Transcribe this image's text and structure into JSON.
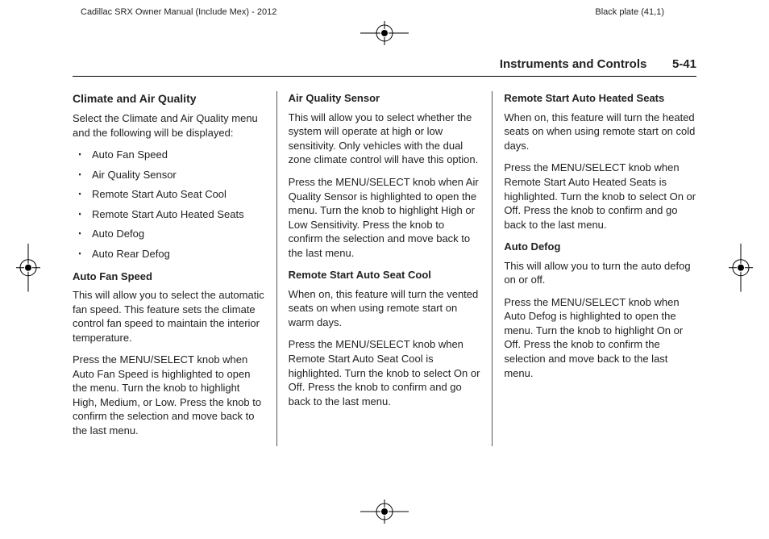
{
  "top": {
    "left": "Cadillac SRX Owner Manual (Include Mex) - 2012",
    "right": "Black plate (41,1)"
  },
  "header": {
    "title": "Instruments and Controls",
    "page": "5-41"
  },
  "col1": {
    "heading": "Climate and Air Quality",
    "intro": "Select the Climate and Air Quality menu and the following will be displayed:",
    "items": [
      "Auto Fan Speed",
      "Air Quality Sensor",
      "Remote Start Auto Seat Cool",
      "Remote Start Auto Heated Seats",
      "Auto Defog",
      "Auto Rear Defog"
    ],
    "sub1_title": "Auto Fan Speed",
    "sub1_p1": "This will allow you to select the automatic fan speed. This feature sets the climate control fan speed to maintain the interior temperature.",
    "sub1_p2": "Press the MENU/SELECT knob when Auto Fan Speed is highlighted to open the menu. Turn the knob to highlight High, Medium, or Low. Press the knob to confirm the selection and move back to the last menu."
  },
  "col2": {
    "sub1_title": "Air Quality Sensor",
    "sub1_p1": "This will allow you to select whether the system will operate at high or low sensitivity. Only vehicles with the dual zone climate control will have this option.",
    "sub1_p2": "Press the MENU/SELECT knob when Air Quality Sensor is highlighted to open the menu. Turn the knob to highlight High or Low Sensitivity. Press the knob to confirm the selection and move back to the last menu.",
    "sub2_title": "Remote Start Auto Seat Cool",
    "sub2_p1": "When on, this feature will turn the vented seats on when using remote start on warm days.",
    "sub2_p2": "Press the MENU/SELECT knob when Remote Start Auto Seat Cool is highlighted. Turn the knob to select On or Off. Press the knob to confirm and go back to the last menu."
  },
  "col3": {
    "sub1_title": "Remote Start Auto Heated Seats",
    "sub1_p1": "When on, this feature will turn the heated seats on when using remote start on cold days.",
    "sub1_p2": "Press the MENU/SELECT knob when Remote Start Auto Heated Seats is highlighted. Turn the knob to select On or Off. Press the knob to confirm and go back to the last menu.",
    "sub2_title": "Auto Defog",
    "sub2_p1": "This will allow you to turn the auto defog on or off.",
    "sub2_p2": "Press the MENU/SELECT knob when Auto Defog is highlighted to open the menu. Turn the knob to highlight On or Off. Press the knob to confirm the selection and move back to the last menu."
  }
}
